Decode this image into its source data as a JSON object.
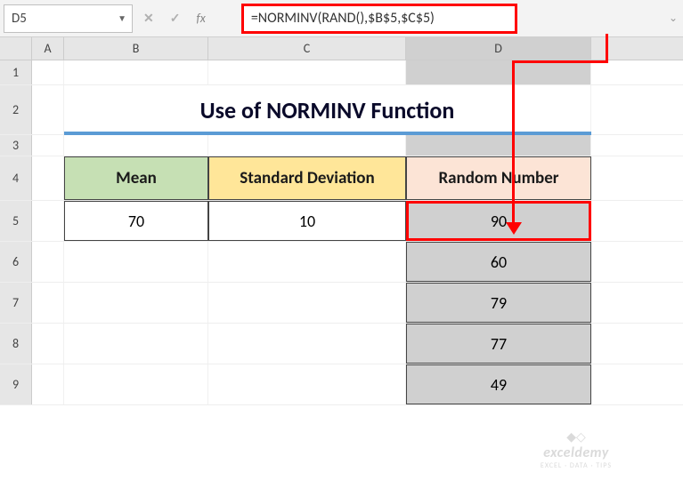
{
  "namebox": {
    "value": "D5"
  },
  "formula_bar": {
    "formula": "=NORMINV(RAND(),$B$5,$C$5)",
    "fx_label": "fx"
  },
  "columns": [
    "A",
    "B",
    "C",
    "D"
  ],
  "rows": [
    "1",
    "2",
    "3",
    "4",
    "5",
    "6",
    "7",
    "8",
    "9"
  ],
  "title": "Use of NORMINV Function",
  "headers": {
    "mean": "Mean",
    "stddev": "Standard Deviation",
    "random": "Random Number"
  },
  "data": {
    "mean": "70",
    "stddev": "10",
    "random": [
      "90",
      "60",
      "79",
      "77",
      "49"
    ]
  },
  "watermark": {
    "brand": "exceldemy",
    "tagline": "EXCEL · DATA · TIPS"
  }
}
